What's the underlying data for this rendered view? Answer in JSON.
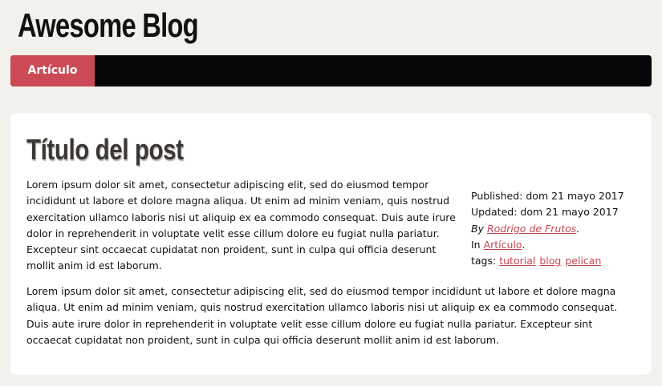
{
  "site": {
    "title": "Awesome Blog"
  },
  "nav": {
    "items": [
      {
        "label": "Artículo"
      }
    ]
  },
  "post": {
    "title": "Título del post",
    "paragraphs": [
      "Lorem ipsum dolor sit amet, consectetur adipiscing elit, sed do eiusmod tempor incididunt ut labore et dolore magna aliqua. Ut enim ad minim veniam, quis nostrud exercitation ullamco laboris nisi ut aliquip ex ea commodo consequat. Duis aute irure dolor in reprehenderit in voluptate velit esse cillum dolore eu fugiat nulla pariatur. Excepteur sint occaecat cupidatat non proident, sunt in culpa qui officia deserunt mollit anim id est laborum.",
      "Lorem ipsum dolor sit amet, consectetur adipiscing elit, sed do eiusmod tempor incididunt ut labore et dolore magna aliqua. Ut enim ad minim veniam, quis nostrud exercitation ullamco laboris nisi ut aliquip ex ea commodo consequat. Duis aute irure dolor in reprehenderit in voluptate velit esse cillum dolore eu fugiat nulla pariatur. Excepteur sint occaecat cupidatat non proident, sunt in culpa qui officia deserunt mollit anim id est laborum."
    ],
    "meta": {
      "published": "Published: dom 21 mayo 2017",
      "updated": "Updated: dom 21 mayo 2017",
      "by_prefix": "By",
      "author": "Rodrigo de Frutos",
      "author_suffix": ".",
      "in_prefix": "In",
      "category": "Artículo",
      "category_suffix": ".",
      "tags_label": "tags:",
      "tags": [
        "tutorial",
        "blog",
        "pelican"
      ]
    }
  },
  "colors": {
    "page_background": "#f3f1ec",
    "navbar_background": "#050608",
    "nav_active": "#cc4a56",
    "link": "#c64652",
    "card_background": "#ffffff",
    "post_title": "#3b3733"
  }
}
